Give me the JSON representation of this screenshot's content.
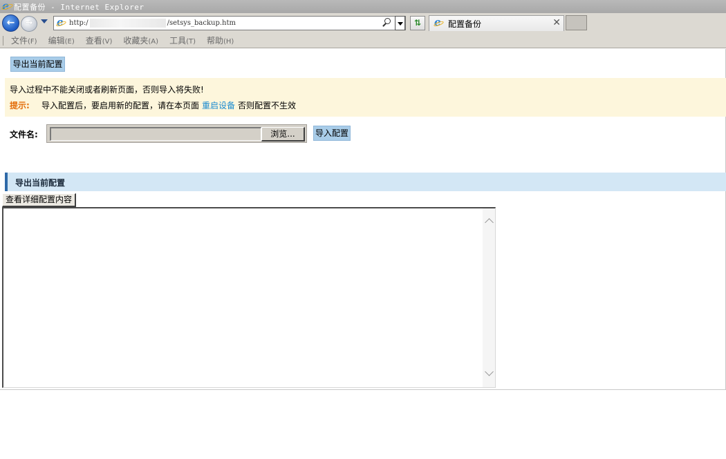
{
  "window": {
    "title": "配置备份 - Internet Explorer"
  },
  "address_bar": {
    "url_prefix": "http:/",
    "url_suffix": "/setsys_backup.htm"
  },
  "tab": {
    "label": "配置备份"
  },
  "menu": {
    "items": [
      {
        "label": "文件",
        "accel": "(F)"
      },
      {
        "label": "编辑",
        "accel": "(E)"
      },
      {
        "label": "查看",
        "accel": "(V)"
      },
      {
        "label": "收藏夹",
        "accel": "(A)"
      },
      {
        "label": "工具",
        "accel": "(T)"
      },
      {
        "label": "帮助",
        "accel": "(H)"
      }
    ]
  },
  "page": {
    "export_button_label": "导出当前配置",
    "notice": {
      "warning": "导入过程中不能关闭或者刷新页面，否则导入将失败!",
      "hint_label": "提示:",
      "hint_before": "导入配置后，要启用新的配置，请在本页面",
      "hint_link": "重启设备",
      "hint_after": "否则配置不生效"
    },
    "file_label": "文件名:",
    "browse_label": "浏览...",
    "import_button_label": "导入配置",
    "section_title": "导出当前配置",
    "detail_button_label": "查看详细配置内容",
    "config_text": ""
  },
  "colors": {
    "notice_bg": "#fdf6dc",
    "hint_color": "#e36c09",
    "link_color": "#1a8ad0",
    "section_bg": "#d3e7f5",
    "section_accent": "#2f6aa8",
    "button_blue": "#a9cde9"
  }
}
